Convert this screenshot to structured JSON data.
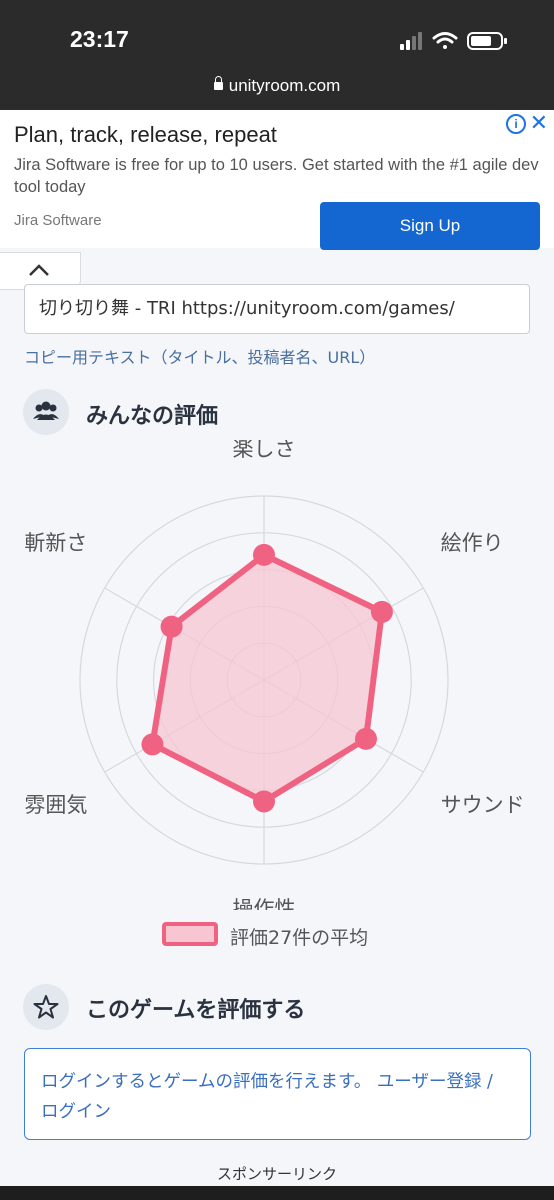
{
  "status_bar": {
    "time": "23:17",
    "url": "unityroom.com"
  },
  "ad": {
    "title": "Plan, track, release, repeat",
    "description": "Jira Software is free for up to 10 users. Get started with the #1 agile dev tool today",
    "brand": "Jira Software",
    "cta": "Sign Up",
    "info_icon": "info-icon",
    "close_icon": "close-icon"
  },
  "share": {
    "copy_text": "切り切り舞 - TRI https://unityroom.com/games/",
    "caption": "コピー用テキスト（タイトル、投稿者名、URL）"
  },
  "ratings": {
    "title": "みんなの評価",
    "icon": "users-icon",
    "legend": "評価27件の平均"
  },
  "chart_data": {
    "type": "radar",
    "categories": [
      "楽しさ",
      "絵作り",
      "サウンド",
      "操作性",
      "雰囲気",
      "斬新さ"
    ],
    "values": [
      3.4,
      3.7,
      3.2,
      3.3,
      3.5,
      2.9
    ],
    "range": [
      0,
      5
    ],
    "rings": 5,
    "fill_color": "#f7c6d2",
    "line_color": "#f06282"
  },
  "rate": {
    "title": "このゲームを評価する",
    "icon": "star-icon",
    "login_text": "ログインするとゲームの評価を行えます。",
    "register_link": "ユーザー登録 / ログイン"
  },
  "sponsor_label": "スポンサーリンク"
}
